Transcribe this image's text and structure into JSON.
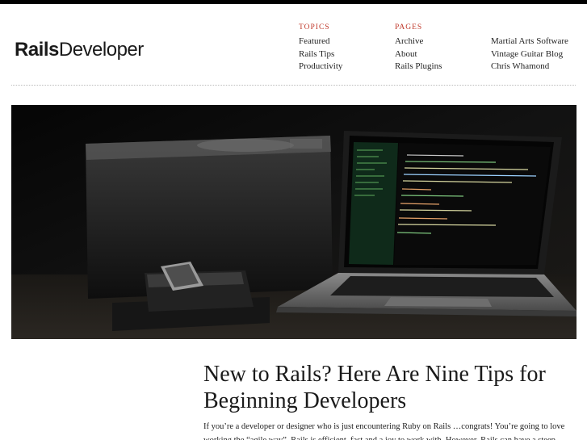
{
  "site": {
    "logo_bold": "Rails",
    "logo_light": "Developer"
  },
  "nav": {
    "topics": {
      "heading": "TOPICS",
      "items": [
        "Featured",
        "Rails Tips",
        "Productivity"
      ]
    },
    "pages": {
      "heading": "PAGES",
      "items": [
        "Archive",
        "About",
        "Rails Plugins"
      ]
    },
    "links": {
      "items": [
        "Martial Arts Software",
        "Vintage Guitar Blog",
        "Chris Whamond"
      ]
    }
  },
  "post": {
    "title": "New to Rails? Here Are Nine Tips for Beginning Developers",
    "excerpt": "If you’re a developer or designer who is just encountering Ruby on Rails …congrats!  You’re going to love working the “agile way”.  Rails is efficient, fast and a joy to work with. However, Rails can have a steep"
  },
  "icons": {
    "hero": "laptop-photo"
  }
}
